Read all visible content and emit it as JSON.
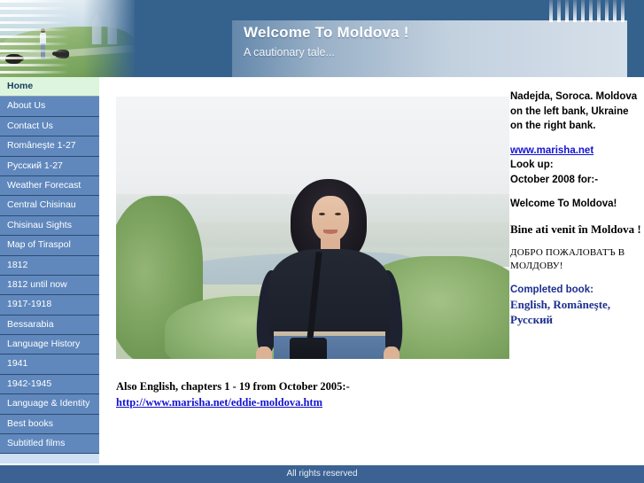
{
  "header": {
    "title": "Welcome To Moldova !",
    "subtitle": "A cautionary tale...",
    "photo_alt": "hillside-with-person-and-cattle"
  },
  "sidebar": {
    "items": [
      {
        "label": "Home",
        "active": true
      },
      {
        "label": "About Us",
        "active": false
      },
      {
        "label": "Contact Us",
        "active": false
      },
      {
        "label": "Româneşte 1-27",
        "active": false
      },
      {
        "label": "Русский 1-27",
        "active": false
      },
      {
        "label": "Weather Forecast",
        "active": false
      },
      {
        "label": "Central Chisinau",
        "active": false
      },
      {
        "label": "Chisinau Sights",
        "active": false
      },
      {
        "label": "Map of Tiraspol",
        "active": false
      },
      {
        "label": "1812",
        "active": false
      },
      {
        "label": "1812 until now",
        "active": false
      },
      {
        "label": "1917-1918",
        "active": false
      },
      {
        "label": "Bessarabia",
        "active": false
      },
      {
        "label": "Language History",
        "active": false
      },
      {
        "label": "1941",
        "active": false
      },
      {
        "label": "1942-1945",
        "active": false
      },
      {
        "label": "Language & Identity",
        "active": false
      },
      {
        "label": "Best books",
        "active": false
      },
      {
        "label": "Subtitled films",
        "active": false
      }
    ]
  },
  "main": {
    "photo_alt": "woman-above-river-valley",
    "side": {
      "caption": "Nadejda, Soroca. Moldova on the left bank, Ukraine on the right bank.",
      "link_label": "www.marisha.net",
      "lookup_line1": "Look up:",
      "lookup_line2": "October 2008 for:-",
      "welcome_en": "Welcome To Moldova!",
      "welcome_ro": "Bine ati venit în Moldova !",
      "welcome_ru": "ДОБРО ПОЖАЛОВАТЪ В МОЛДОВУ!",
      "completed_label": "Completed book:",
      "completed_langs": "English, Româneşte, Русский"
    },
    "bottom": {
      "line1": "Also English, chapters 1 - 19 from October 2005:-",
      "link": "http://www.marisha.net/eddie-moldova.htm"
    }
  },
  "footer": {
    "text": "All rights reserved"
  },
  "colors": {
    "header_blue": "#35618d",
    "nav_blue": "#6088bd",
    "nav_active_green": "#ddf5dd",
    "sidebar_bg": "#cfe0f5",
    "footer_blue": "#3b6292",
    "link_blue": "#1414d2",
    "navy_text": "#1b2f8f"
  }
}
